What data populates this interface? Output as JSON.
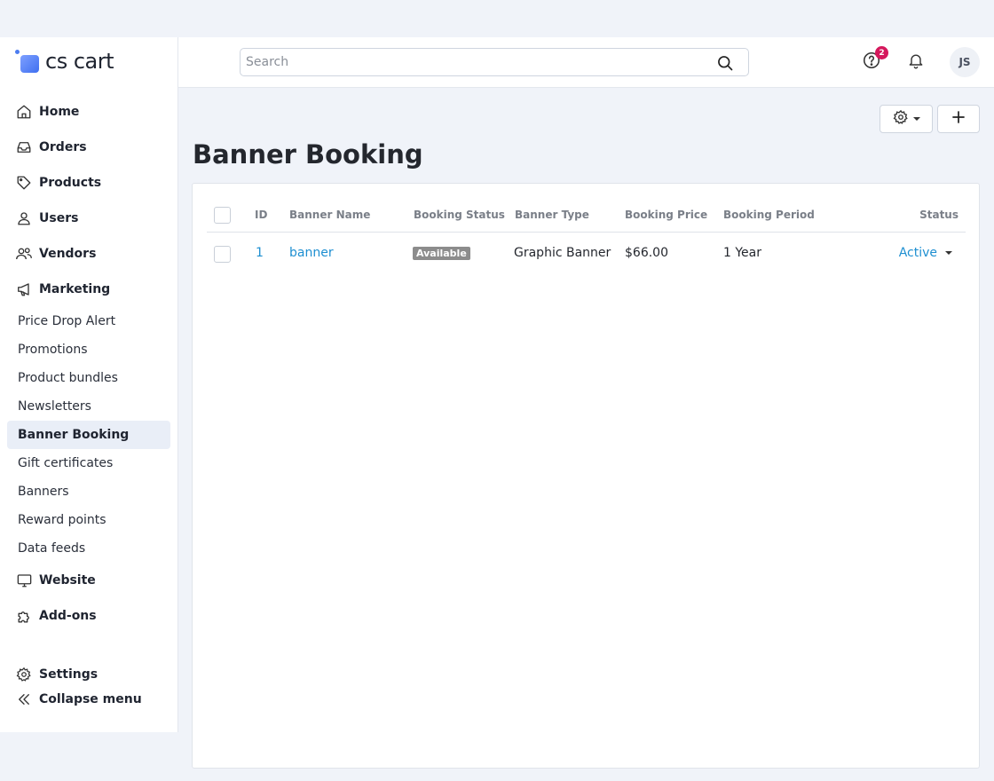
{
  "brand": {
    "logo_text": "cs cart"
  },
  "sidebar": {
    "main_items": [
      {
        "label": "Home",
        "icon": "home-icon"
      },
      {
        "label": "Orders",
        "icon": "inbox-icon"
      },
      {
        "label": "Products",
        "icon": "tag-icon"
      },
      {
        "label": "Users",
        "icon": "user-icon"
      },
      {
        "label": "Vendors",
        "icon": "users-icon"
      },
      {
        "label": "Marketing",
        "icon": "megaphone-icon"
      }
    ],
    "marketing_sub": [
      {
        "label": "Price Drop Alert"
      },
      {
        "label": "Promotions"
      },
      {
        "label": "Product bundles"
      },
      {
        "label": "Newsletters"
      },
      {
        "label": "Banner Booking",
        "active": true
      },
      {
        "label": "Gift certificates"
      },
      {
        "label": "Banners"
      },
      {
        "label": "Reward points"
      },
      {
        "label": "Data feeds"
      }
    ],
    "more_items": [
      {
        "label": "Website",
        "icon": "monitor-icon"
      },
      {
        "label": "Add-ons",
        "icon": "puzzle-icon"
      }
    ],
    "settings_label": "Settings",
    "collapse_label": "Collapse menu"
  },
  "header": {
    "search_placeholder": "Search",
    "help_badge": "2",
    "avatar_initials": "JS"
  },
  "page": {
    "title": "Banner Booking"
  },
  "table": {
    "columns": [
      "ID",
      "Banner Name",
      "Booking Status",
      "Banner Type",
      "Booking Price",
      "Booking Period",
      "Status"
    ],
    "rows": [
      {
        "id": "1",
        "banner_name": "banner",
        "booking_status": "Available",
        "banner_type": "Graphic Banner",
        "booking_price": "$66.00",
        "booking_period": "1 Year",
        "status": "Active"
      }
    ]
  },
  "colors": {
    "link": "#1e8fd1",
    "badge": "#d5185c",
    "tag": "#8c8c8c"
  }
}
